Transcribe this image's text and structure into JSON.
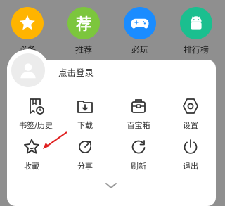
{
  "apps": [
    {
      "label": "必备",
      "icon": "star-icon",
      "color": "#ffb400"
    },
    {
      "label": "推荐",
      "icon": "recommend-icon",
      "color": "#7cc63d",
      "icon_text": "荐"
    },
    {
      "label": "必玩",
      "icon": "gamepad-icon",
      "color": "#1a8cff"
    },
    {
      "label": "排行榜",
      "icon": "android-icon",
      "color": "#1bbf8f"
    }
  ],
  "login": {
    "label": "点击登录",
    "icon": "avatar-icon"
  },
  "menu": [
    {
      "label": "书签/历史",
      "icon": "bookmark-history-icon"
    },
    {
      "label": "下载",
      "icon": "download-icon"
    },
    {
      "label": "百宝箱",
      "icon": "toolbox-icon"
    },
    {
      "label": "设置",
      "icon": "settings-icon"
    },
    {
      "label": "收藏",
      "icon": "favorite-star-icon"
    },
    {
      "label": "分享",
      "icon": "share-icon"
    },
    {
      "label": "刷新",
      "icon": "refresh-icon"
    },
    {
      "label": "退出",
      "icon": "power-icon"
    }
  ],
  "colors": {
    "annotation_arrow": "#e02020",
    "overlay": "#8f8f8f"
  }
}
